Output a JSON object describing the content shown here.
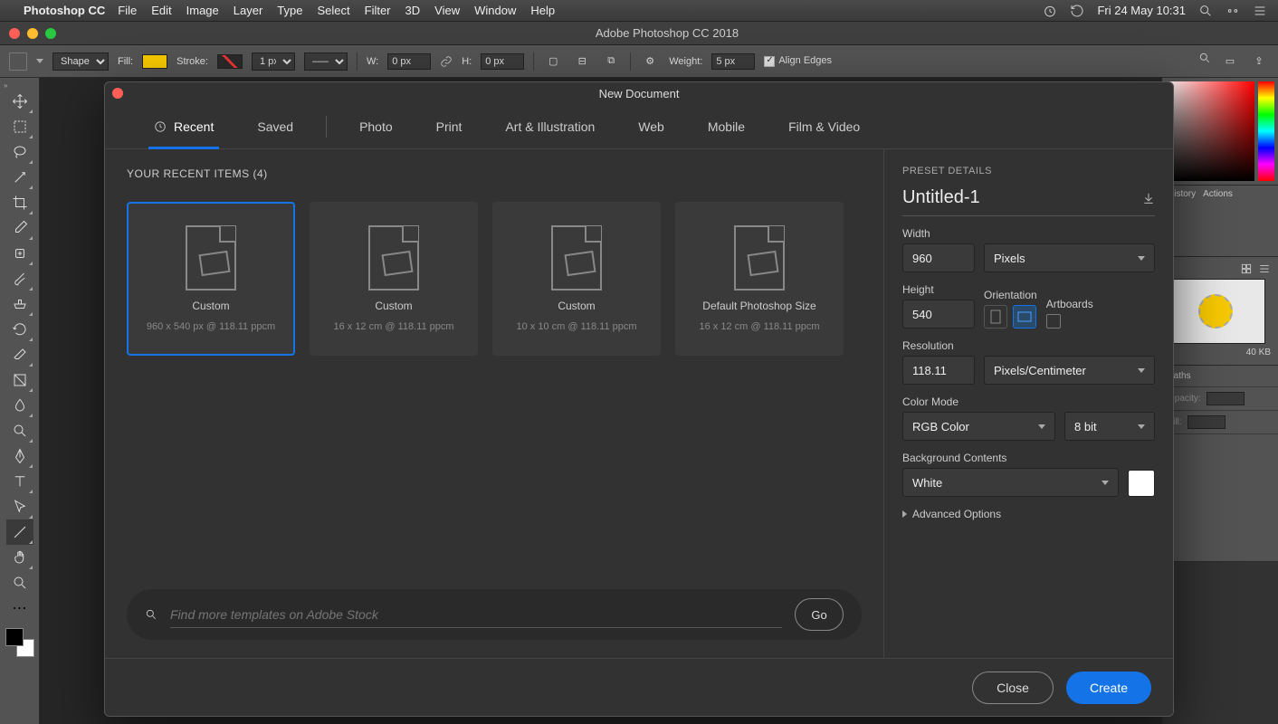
{
  "menubar": {
    "app": "Photoshop CC",
    "items": [
      "File",
      "Edit",
      "Image",
      "Layer",
      "Type",
      "Select",
      "Filter",
      "3D",
      "View",
      "Window",
      "Help"
    ],
    "datetime": "Fri 24 May  10:31"
  },
  "window": {
    "title": "Adobe Photoshop CC 2018"
  },
  "optbar": {
    "shapeMode": "Shape",
    "fillLabel": "Fill:",
    "strokeLabel": "Stroke:",
    "strokeWidth": "1 px",
    "wLabel": "W:",
    "wVal": "0 px",
    "hLabel": "H:",
    "hVal": "0 px",
    "weightLabel": "Weight:",
    "weightVal": "5 px",
    "alignEdges": "Align Edges"
  },
  "dialog": {
    "title": "New Document",
    "tabs": [
      "Recent",
      "Saved",
      "Photo",
      "Print",
      "Art & Illustration",
      "Web",
      "Mobile",
      "Film & Video"
    ],
    "activeTab": 0,
    "recentLabel": "YOUR RECENT ITEMS  (4)",
    "presets": [
      {
        "name": "Custom",
        "dim": "960 x 540 px @ 118.11 ppcm"
      },
      {
        "name": "Custom",
        "dim": "16 x 12 cm @ 118.11 ppcm"
      },
      {
        "name": "Custom",
        "dim": "10 x 10 cm @ 118.11 ppcm"
      },
      {
        "name": "Default Photoshop Size",
        "dim": "16 x 12 cm @ 118.11 ppcm"
      }
    ],
    "searchPlaceholder": "Find more templates on Adobe Stock",
    "goLabel": "Go",
    "details": {
      "sectLabel": "PRESET DETAILS",
      "name": "Untitled-1",
      "widthLabel": "Width",
      "width": "960",
      "widthUnit": "Pixels",
      "heightLabel": "Height",
      "height": "540",
      "orientLabel": "Orientation",
      "artLabel": "Artboards",
      "resLabel": "Resolution",
      "res": "118.11",
      "resUnit": "Pixels/Centimeter",
      "modeLabel": "Color Mode",
      "mode": "RGB Color",
      "depth": "8 bit",
      "bgLabel": "Background Contents",
      "bg": "White",
      "advLabel": "Advanced Options"
    },
    "closeLabel": "Close",
    "createLabel": "Create"
  },
  "rightpanels": {
    "historyTab": "History",
    "actionsTab": "Actions",
    "libSize": "40 KB",
    "pathsTab": "Paths",
    "opacityLabel": "Opacity:",
    "fillLabel": "Fill:"
  },
  "icons": {
    "clock": "clock",
    "history": "history",
    "search": "search",
    "grid": "grid",
    "hamburger": "menu"
  }
}
